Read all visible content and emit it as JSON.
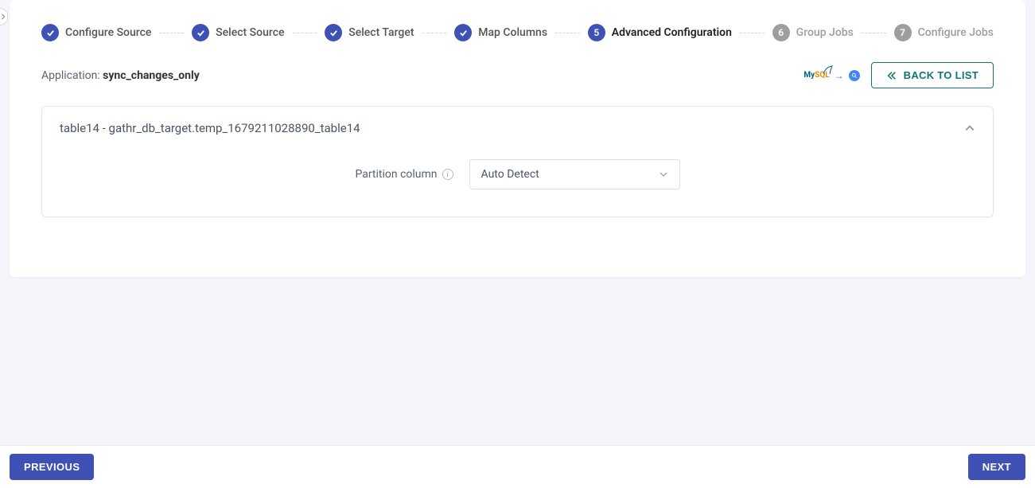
{
  "stepper": [
    {
      "label": "Configure Source",
      "state": "done"
    },
    {
      "label": "Select Source",
      "state": "done"
    },
    {
      "label": "Select Target",
      "state": "done"
    },
    {
      "label": "Map Columns",
      "state": "done"
    },
    {
      "label": "Advanced Configuration",
      "state": "current",
      "num": "5"
    },
    {
      "label": "Group Jobs",
      "state": "pending",
      "num": "6"
    },
    {
      "label": "Configure Jobs",
      "state": "pending",
      "num": "7"
    }
  ],
  "application": {
    "prefix": "Application: ",
    "name": "sync_changes_only"
  },
  "back_button": "BACK TO LIST",
  "panel": {
    "title": "table14 - gathr_db_target.temp_1679211028890_table14",
    "field_label": "Partition column",
    "select_value": "Auto Detect"
  },
  "footer": {
    "previous": "PREVIOUS",
    "next": "NEXT"
  }
}
